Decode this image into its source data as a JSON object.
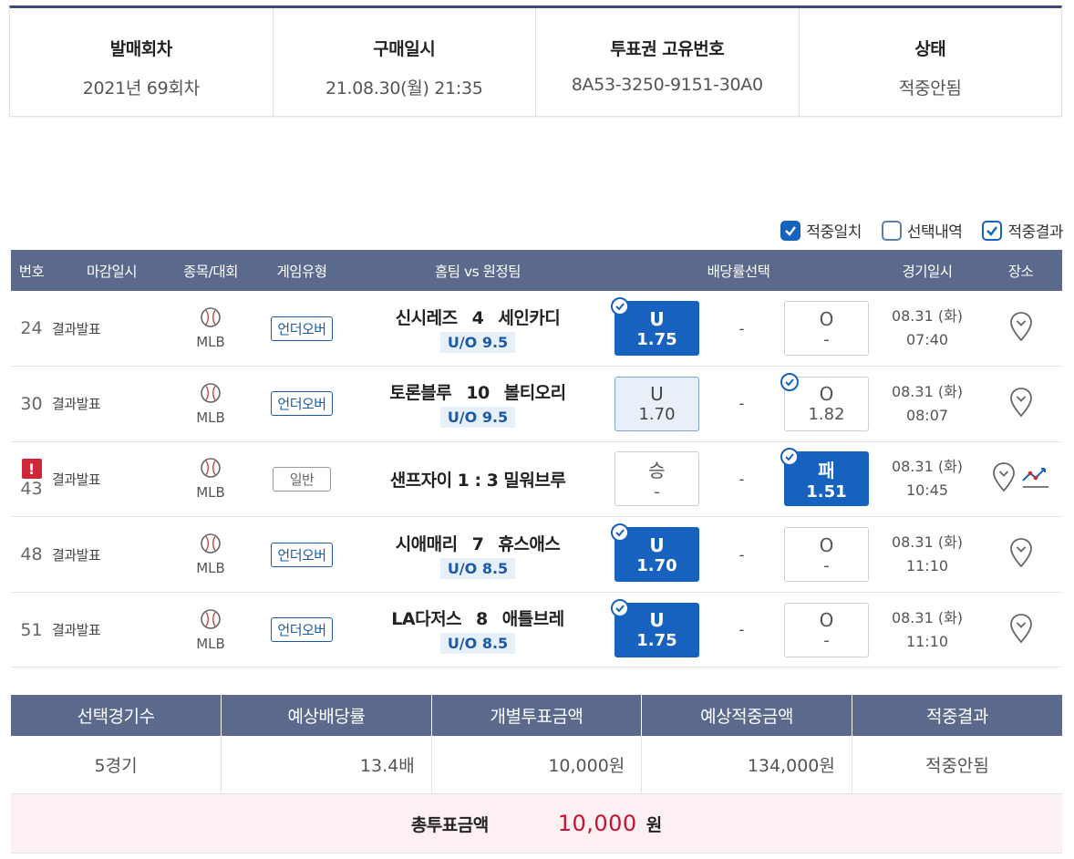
{
  "summary": [
    {
      "label": "발매회차",
      "value": "2021년 69회차"
    },
    {
      "label": "구매일시",
      "value": "21.08.30(월) 21:35"
    },
    {
      "label": "투표권 고유번호",
      "value": "8A53-3250-9151-30A0"
    },
    {
      "label": "상태",
      "value": "적중안됨"
    }
  ],
  "filters": [
    {
      "label": "적중일치",
      "state": "checked-filled"
    },
    {
      "label": "선택내역",
      "state": "unchecked"
    },
    {
      "label": "적중결과",
      "state": "checked-outline"
    }
  ],
  "table": {
    "headers": [
      "번호",
      "마감일시",
      "종목/대회",
      "게임유형",
      "홈팀 vs 원정팀",
      "배당률선택",
      "경기일시",
      "장소"
    ],
    "rows": [
      {
        "no": "24",
        "warn": false,
        "deadline": "결과발표",
        "league": "MLB",
        "game_type": "언더오버",
        "home": "신시레즈",
        "score": "4",
        "away": "세인카디",
        "uo": "U/O 9.5",
        "left": {
          "label": "U",
          "odds": "1.75",
          "style": "sel",
          "check": true
        },
        "mid": "-",
        "right": {
          "label": "O",
          "odds": "-",
          "style": "plain",
          "check": false
        },
        "date": "08.31 (화)",
        "time": "07:40",
        "chart": false
      },
      {
        "no": "30",
        "warn": false,
        "deadline": "결과발표",
        "league": "MLB",
        "game_type": "언더오버",
        "home": "토론블루",
        "score": "10",
        "away": "볼티오리",
        "uo": "U/O 9.5",
        "left": {
          "label": "U",
          "odds": "1.70",
          "style": "light",
          "check": false
        },
        "mid": "-",
        "right": {
          "label": "O",
          "odds": "1.82",
          "style": "plain",
          "check": true
        },
        "date": "08.31 (화)",
        "time": "08:07",
        "chart": false
      },
      {
        "no": "43",
        "warn": true,
        "deadline": "결과발표",
        "league": "MLB",
        "game_type": "일반",
        "home": "샌프자이",
        "score": "1 : 3",
        "away": "밀워브루",
        "uo": "",
        "left": {
          "label": "승",
          "odds": "-",
          "style": "plain",
          "check": false
        },
        "mid": "-",
        "right": {
          "label": "패",
          "odds": "1.51",
          "style": "sel",
          "check": true
        },
        "date": "08.31 (화)",
        "time": "10:45",
        "chart": true
      },
      {
        "no": "48",
        "warn": false,
        "deadline": "결과발표",
        "league": "MLB",
        "game_type": "언더오버",
        "home": "시애매리",
        "score": "7",
        "away": "휴스애스",
        "uo": "U/O 8.5",
        "left": {
          "label": "U",
          "odds": "1.70",
          "style": "sel",
          "check": true
        },
        "mid": "-",
        "right": {
          "label": "O",
          "odds": "-",
          "style": "plain",
          "check": false
        },
        "date": "08.31 (화)",
        "time": "11:10",
        "chart": false
      },
      {
        "no": "51",
        "warn": false,
        "deadline": "결과발표",
        "league": "MLB",
        "game_type": "언더오버",
        "home": "LA다저스",
        "score": "8",
        "away": "애틀브레",
        "uo": "U/O 8.5",
        "left": {
          "label": "U",
          "odds": "1.75",
          "style": "sel",
          "check": true
        },
        "mid": "-",
        "right": {
          "label": "O",
          "odds": "-",
          "style": "plain",
          "check": false
        },
        "date": "08.31 (화)",
        "time": "11:10",
        "chart": false
      }
    ]
  },
  "bet_summary": {
    "headers": [
      "선택경기수",
      "예상배당률",
      "개별투표금액",
      "예상적중금액",
      "적중결과"
    ],
    "values": [
      "5경기",
      "13.4배",
      "10,000원",
      "134,000원",
      "적중안됨"
    ]
  },
  "total": {
    "label": "총투표금액",
    "amount": "10,000",
    "unit": "원"
  },
  "colors": {
    "header_bg": "#5b6a8c",
    "accent": "#1662be",
    "top_border": "#3b4a7a",
    "total_amount": "#c41230",
    "total_bg": "#fdf0f2",
    "warn": "#d0263a"
  },
  "icons": {
    "sport": "baseball-icon",
    "location": "map-pin-icon",
    "stats": "trend-chart-icon",
    "check": "check-icon",
    "warning": "exclamation-icon"
  }
}
